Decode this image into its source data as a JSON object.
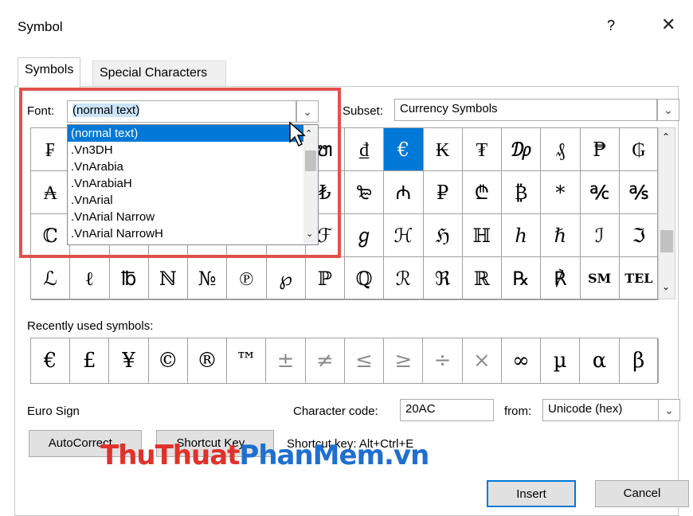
{
  "dialog": {
    "title": "Symbol",
    "help_label": "?",
    "close_label": "✕"
  },
  "tabs": [
    {
      "label": "Symbols",
      "active": true
    },
    {
      "label": "Special Characters",
      "active": false
    }
  ],
  "font": {
    "label": "Font:",
    "value": "(normal text)",
    "options": [
      "(normal text)",
      ".Vn3DH",
      ".VnArabia",
      ".VnArabiaH",
      ".VnArial",
      ".VnArial Narrow",
      ".VnArial NarrowH"
    ]
  },
  "subset": {
    "label": "Subset:",
    "value": "Currency Symbols"
  },
  "symbol_grid": {
    "rows": [
      [
        "₣",
        "",
        "",
        "",
        "",
        "",
        "",
        "ຫ",
        "₫",
        "€",
        "₭",
        "₮",
        "₯",
        "₰",
        "₱",
        "₲"
      ],
      [
        "₳",
        "",
        "",
        "",
        "",
        "",
        "",
        "₺",
        "₻",
        "₼",
        "₽",
        "₾",
        "₿",
        "*",
        "℀",
        "℁"
      ],
      [
        "ℂ",
        "",
        "",
        "",
        "",
        "",
        "",
        "ℱ",
        "ℊ",
        "ℋ",
        "ℌ",
        "ℍ",
        "ℎ",
        "ℏ",
        "ℐ",
        "ℑ"
      ],
      [
        "ℒ",
        "ℓ",
        "℔",
        "ℕ",
        "№",
        "℗",
        "℘",
        "ℙ",
        "ℚ",
        "ℛ",
        "ℜ",
        "ℝ",
        "℞",
        "℟",
        "SM",
        "TEL"
      ]
    ],
    "selected": "€"
  },
  "recent": {
    "label": "Recently used symbols:",
    "symbols": [
      "€",
      "£",
      "¥",
      "©",
      "®",
      "™",
      "±",
      "≠",
      "≤",
      "≥",
      "÷",
      "×",
      "∞",
      "µ",
      "α",
      "β"
    ]
  },
  "char_name": "Euro Sign",
  "char_code": {
    "label": "Character code:",
    "value": "20AC"
  },
  "from": {
    "label": "from:",
    "value": "Unicode (hex)"
  },
  "buttons": {
    "autocorrect": "AutoCorrect...",
    "shortcut_key": "Shortcut Key...",
    "insert": "Insert",
    "cancel": "Cancel"
  },
  "shortcut_text": "Shortcut key: Alt+Ctrl+E",
  "watermark": {
    "part1": "ThuThuat",
    "part2": "PhanMem",
    "part3": ".vn"
  },
  "colors": {
    "selection": "#0078d7",
    "highlight_box": "#e0524a",
    "watermark_red": "#e0312a",
    "watermark_blue": "#1f6fd0"
  }
}
